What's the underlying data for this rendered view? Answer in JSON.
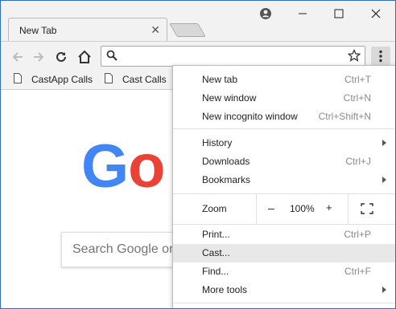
{
  "tab": {
    "title": "New Tab"
  },
  "bookmarks": [
    {
      "label": "CastApp Calls"
    },
    {
      "label": "Cast Calls"
    }
  ],
  "google": {
    "logo_letters": [
      {
        "char": "G",
        "color": "#4285f4"
      },
      {
        "char": "o",
        "color": "#ea4335"
      }
    ],
    "search_placeholder": "Search Google or"
  },
  "menu": {
    "items": [
      {
        "label": "New tab",
        "shortcut": "Ctrl+T"
      },
      {
        "label": "New window",
        "shortcut": "Ctrl+N"
      },
      {
        "label": "New incognito window",
        "shortcut": "Ctrl+Shift+N"
      },
      {
        "label": "History",
        "shortcut": ""
      },
      {
        "label": "Downloads",
        "shortcut": "Ctrl+J"
      },
      {
        "label": "Bookmarks",
        "shortcut": ""
      },
      {
        "label": "Print...",
        "shortcut": "Ctrl+P"
      },
      {
        "label": "Cast...",
        "shortcut": ""
      },
      {
        "label": "Find...",
        "shortcut": "Ctrl+F"
      },
      {
        "label": "More tools",
        "shortcut": ""
      }
    ],
    "zoom": {
      "label": "Zoom",
      "minus": "–",
      "value": "100%",
      "plus": "+"
    }
  }
}
